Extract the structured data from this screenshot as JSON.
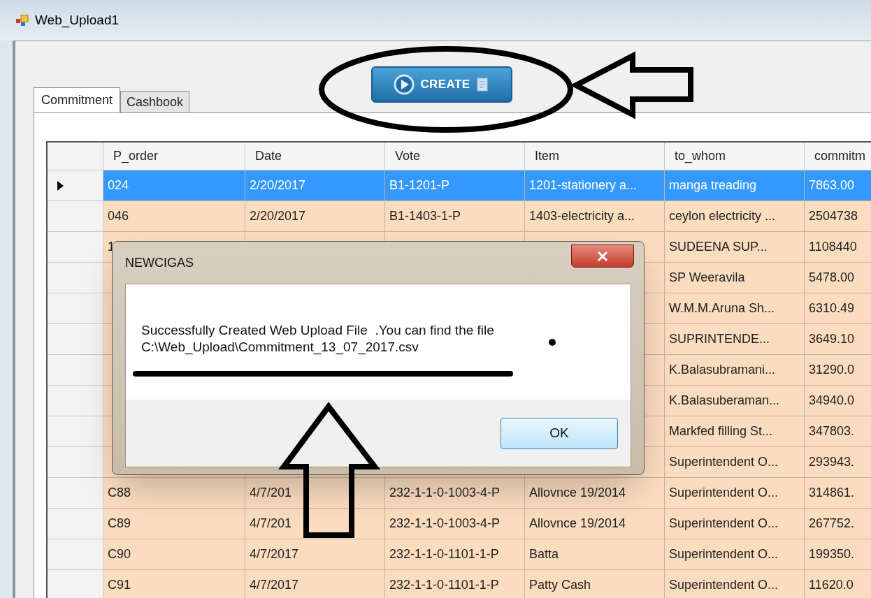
{
  "window": {
    "title": "Web_Upload1"
  },
  "create_button": {
    "label": "CREATE"
  },
  "tabs": [
    {
      "label": "Commitment",
      "selected": true
    },
    {
      "label": "Cashbook",
      "selected": false
    }
  ],
  "table": {
    "columns": [
      "P_order",
      "Date",
      "Vote",
      "Item",
      "to_whom",
      "commitm"
    ],
    "rows": [
      {
        "selected": true,
        "cells": [
          "024",
          "2/20/2017",
          "B1-1201-P",
          "1201-stationery a...",
          "manga treading",
          "7863.00"
        ]
      },
      {
        "selected": false,
        "cells": [
          "046",
          "2/20/2017",
          "B1-1403-1-P",
          "1403-electricity a...",
          "ceylon electricity ...",
          "2504738"
        ]
      },
      {
        "selected": false,
        "cells": [
          "1",
          null,
          null,
          null,
          "SUDEENA SUP...",
          "1108440"
        ]
      },
      {
        "selected": false,
        "cells": [
          null,
          null,
          null,
          null,
          "SP Weeravila",
          "5478.00"
        ]
      },
      {
        "selected": false,
        "cells": [
          null,
          null,
          null,
          null,
          "W.M.M.Aruna Sh...",
          "6310.49"
        ]
      },
      {
        "selected": false,
        "cells": [
          null,
          null,
          null,
          null,
          "SUPRINTENDE...",
          "3649.10"
        ]
      },
      {
        "selected": false,
        "cells": [
          null,
          null,
          null,
          null,
          "K.Balasubramani...",
          "31290.0"
        ]
      },
      {
        "selected": false,
        "cells": [
          null,
          null,
          null,
          null,
          "K.Balasuberaman...",
          "34940.0"
        ]
      },
      {
        "selected": false,
        "cells": [
          null,
          null,
          null,
          null,
          "Markfed filling St...",
          "347803."
        ]
      },
      {
        "selected": false,
        "cells": [
          null,
          null,
          null,
          null,
          "Superintendent O...",
          "293943."
        ]
      },
      {
        "selected": false,
        "cells": [
          "C88",
          "4/7/201",
          "232-1-1-0-1003-4-P",
          "Allovnce 19/2014",
          "Superintendent O...",
          "314861."
        ]
      },
      {
        "selected": false,
        "cells": [
          "C89",
          "4/7/201",
          "232-1-1-0-1003-4-P",
          "Allovnce 19/2014",
          "Superintendent O...",
          "267752."
        ]
      },
      {
        "selected": false,
        "cells": [
          "C90",
          "4/7/2017",
          "232-1-1-0-1101-1-P",
          "Batta",
          "Superintendent O...",
          "199350."
        ]
      },
      {
        "selected": false,
        "cells": [
          "C91",
          "4/7/2017",
          "232-1-1-0-1101-1-P",
          "Patty Cash",
          "Superintendent O...",
          "11620.0"
        ]
      }
    ]
  },
  "dialog": {
    "title": "NEWCIGAS",
    "message_lines": [
      "Successfully Created Web Upload File  .You can find the file",
      "C:\\Web_Upload\\Commitment_13_07_2017.csv"
    ],
    "ok_button": "OK"
  }
}
